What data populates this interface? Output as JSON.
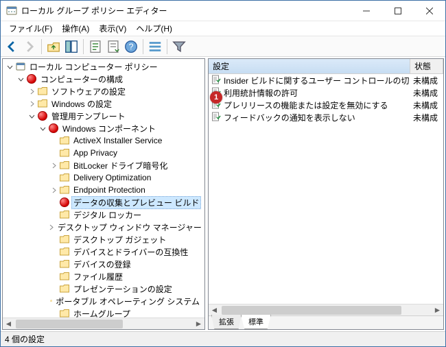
{
  "window": {
    "title": "ローカル グループ ポリシー エディター"
  },
  "menu": {
    "file": "ファイル(F)",
    "action": "操作(A)",
    "view": "表示(V)",
    "help": "ヘルプ(H)"
  },
  "toolbar": {
    "back": "back",
    "fwd": "forward",
    "up": "up",
    "props": "properties",
    "refresh": "refresh",
    "export": "export",
    "help": "help",
    "details": "details",
    "filter": "filter"
  },
  "tree": {
    "root": "ローカル コンピューター ポリシー",
    "comp_config": "コンピューターの構成",
    "software": "ソフトウェアの設定",
    "windows_settings": "Windows の設定",
    "admin_templates": "管理用テンプレート",
    "win_components": "Windows コンポーネント",
    "items": [
      "ActiveX Installer Service",
      "App Privacy",
      "BitLocker ドライブ暗号化",
      "Delivery Optimization",
      "Endpoint Protection",
      "データの収集とプレビュー ビルド",
      "デジタル ロッカー",
      "デスクトップ ウィンドウ マネージャー",
      "デスクトップ ガジェット",
      "デバイスとドライバーの互換性",
      "デバイスの登録",
      "ファイル履歴",
      "プレゼンテーションの設定",
      "ポータブル オペレーティング システム",
      "ホームグループ"
    ],
    "selected_index": 5
  },
  "list": {
    "col_name": "設定",
    "col_state": "状態",
    "rows": [
      {
        "name": "Insider ビルドに関するユーザー コントロールの切り替え",
        "state": "未構成"
      },
      {
        "name": "利用統計情報の許可",
        "state": "未構成"
      },
      {
        "name": "プレリリースの機能または設定を無効にする",
        "state": "未構成"
      },
      {
        "name": "フィードバックの通知を表示しない",
        "state": "未構成"
      }
    ]
  },
  "tabs": {
    "extended": "拡張",
    "standard": "標準"
  },
  "status": "4 個の設定",
  "marker": "1"
}
